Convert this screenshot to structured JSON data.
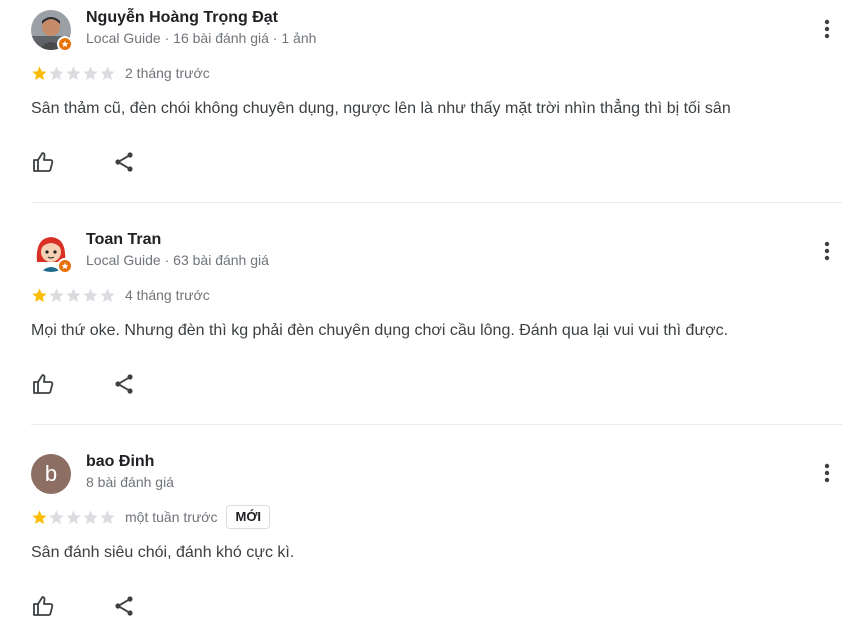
{
  "reviews": [
    {
      "name": "Nguyễn Hoàng Trọng Đạt",
      "meta": "Local Guide · 16 bài đánh giá · 1 ảnh",
      "rating": 1,
      "max_rating": 5,
      "time": "2 tháng trước",
      "text": "Sân thảm cũ, đèn chói không chuyên dụng, ngược lên là như thấy mặt trời nhìn thẳng thì bị tối sân",
      "avatar": "photo-avatar"
    },
    {
      "name": "Toan Tran",
      "meta": "Local Guide · 63 bài đánh giá",
      "rating": 1,
      "max_rating": 5,
      "time": "4 tháng trước",
      "text": "Mọi thứ oke. Nhưng đèn thì kg phải đèn chuyên dụng chơi cầu lông. Đánh qua lại vui vui thì được.",
      "avatar": "cartoon-avatar"
    },
    {
      "name": "bao Đinh",
      "meta": "8 bài đánh giá",
      "rating": 1,
      "max_rating": 5,
      "time": "một tuần trước",
      "badge": "MỚI",
      "text": "Sân đánh siêu chói, đánh khó cực kì.",
      "avatar_letter": "b",
      "avatar_color": "#8d6e63"
    }
  ],
  "colors": {
    "star_filled": "#fbbc04",
    "star_empty": "#dadce0",
    "guide_badge": "#e8710a",
    "icon": "#3c4043"
  },
  "icons": {
    "more": "more-vert-icon",
    "like": "thumb-up-icon",
    "share": "share-icon",
    "star": "star-icon"
  }
}
